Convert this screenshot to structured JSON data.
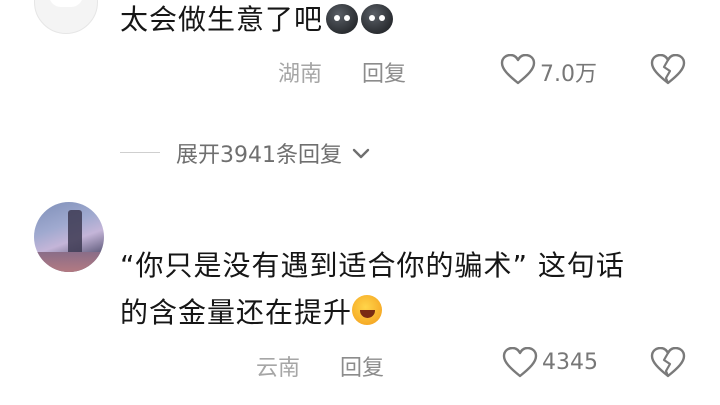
{
  "comments": [
    {
      "text": "太会做生意了吧",
      "location": "湖南",
      "reply_label": "回复",
      "like_count": "7.0万",
      "expand_label": "展开3941条回复"
    },
    {
      "text_line1": "“你只是没有遇到适合你的骗术” 这句话",
      "text_line2": "的含金量还在提升",
      "location": "云南",
      "reply_label": "回复",
      "like_count": "4345"
    }
  ],
  "icons": {
    "like": "heart-outline-icon",
    "dislike": "broken-heart-icon",
    "expand": "chevron-down-icon",
    "emoji1": "dark-blob-emoji",
    "emoji2": "laughing-tears-emoji"
  },
  "colors": {
    "meta": "#a6a6a6",
    "text": "#161616",
    "background": "#ffffff"
  }
}
